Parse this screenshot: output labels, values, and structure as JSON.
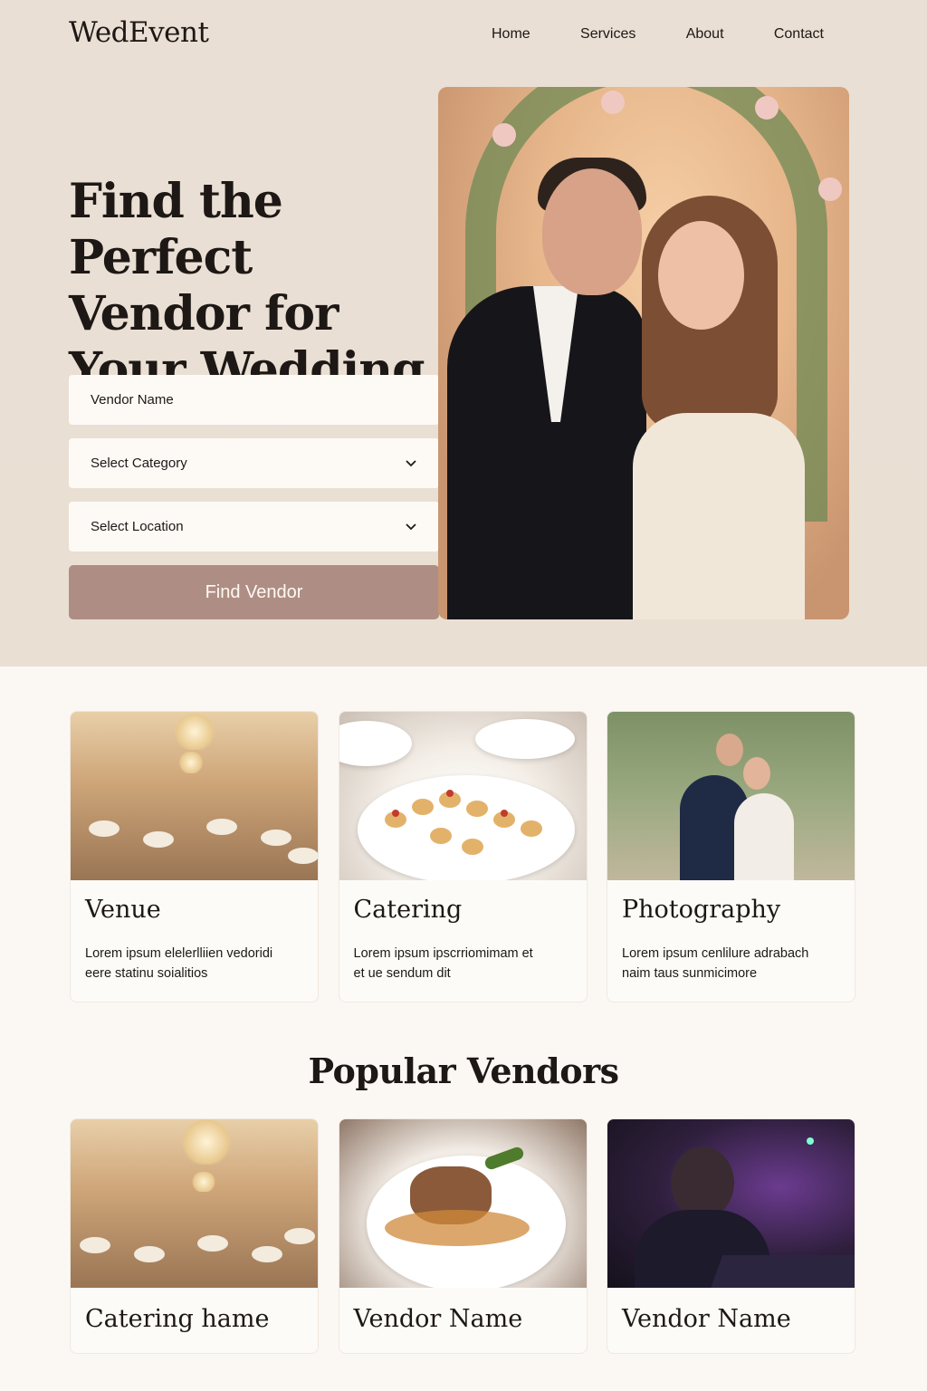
{
  "brand": {
    "logo": "WedEvent"
  },
  "nav": {
    "items": [
      "Home",
      "Services",
      "About",
      "Contact"
    ]
  },
  "hero": {
    "headline_line1": "Find the Perfect",
    "headline_line2": "Vendor for",
    "headline_line3": "Your Wedding",
    "search": {
      "vendor_placeholder": "Vendor Name",
      "category_value": "Select Category",
      "location_value": "Select Location",
      "submit_label": "Find Vendor"
    },
    "image_icon": "couple-photo"
  },
  "categories": [
    {
      "title": "Venue",
      "desc_line1": "Lorem ipsum elelerlliien vedoridi",
      "desc_line2": "eere statinu soialitios",
      "image_icon": "venue-hall-photo"
    },
    {
      "title": "Catering",
      "desc_line1": "Lorem ipsum ipscrriomimam et",
      "desc_line2": "et ue sendum dit",
      "image_icon": "catering-food-photo"
    },
    {
      "title": "Photography",
      "desc_line1": "Lorem ipsum cenlilure adrabach",
      "desc_line2": "naim taus sunmicimore",
      "image_icon": "couple-outdoor-photo"
    }
  ],
  "popular": {
    "title": "Popular Vendors",
    "vendors": [
      {
        "name": "Catering hame",
        "image_icon": "ballroom-photo"
      },
      {
        "name": "Vendor Name",
        "image_icon": "plated-dish-photo"
      },
      {
        "name": "Vendor Name",
        "image_icon": "dj-photo"
      }
    ]
  },
  "colors": {
    "hero_background": "#e9dfd4",
    "page_background": "#fbf8f4",
    "button": "#ae8e84",
    "text": "#1d1815"
  }
}
